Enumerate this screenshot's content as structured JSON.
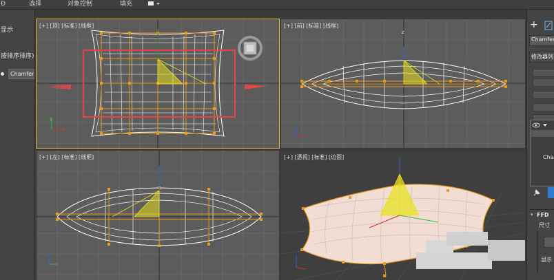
{
  "menubar": {
    "item_0": "Đ",
    "item_1": "选择",
    "item_2": "对象控制",
    "item_3": "填充"
  },
  "left_panel": {
    "display": "显示",
    "sort": "按排序排序)",
    "object_name": "Chamfer"
  },
  "viewports": {
    "top": "[+] [顶] [标准] [线框]",
    "front": "[+] [前] [标准] [线框]",
    "left": "[+] [左] [标准] [线框]",
    "persp": "[+] [透视] [标准] [边面]"
  },
  "axes": {
    "x": "x",
    "y": "y",
    "z": "z"
  },
  "right_panel": {
    "plus": "+",
    "object_name": "Chamfer",
    "modifier_list": "修改器列",
    "stack_item": "Cha",
    "ffd": "FFD",
    "size": "尺寸",
    "display": "显示"
  },
  "colors": {
    "accent": "#e0b640",
    "selection_box": "#e04848",
    "wire": "#ffffff",
    "lattice": "#e89a1c",
    "gizmo": "#e8e020"
  }
}
